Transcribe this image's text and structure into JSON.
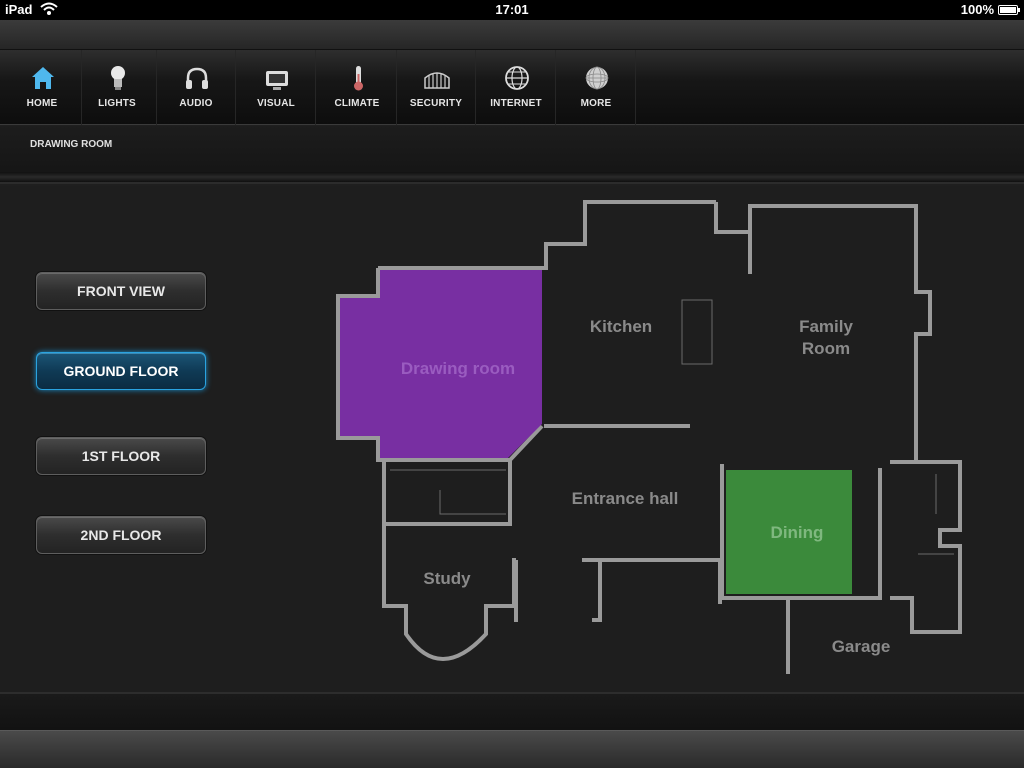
{
  "status_bar": {
    "carrier": "iPad",
    "time": "17:01",
    "battery": "100%",
    "wifi_icon": "wifi-icon",
    "battery_icon": "battery-icon"
  },
  "nav": {
    "items": [
      {
        "label": "HOME",
        "icon": "home-icon",
        "active": true
      },
      {
        "label": "LIGHTS",
        "icon": "lightbulb-icon"
      },
      {
        "label": "AUDIO",
        "icon": "headphones-icon"
      },
      {
        "label": "VISUAL",
        "icon": "tv-icon"
      },
      {
        "label": "CLIMATE",
        "icon": "thermometer-icon"
      },
      {
        "label": "SECURITY",
        "icon": "gate-icon"
      },
      {
        "label": "INTERNET",
        "icon": "globe-icon"
      },
      {
        "label": "MORE",
        "icon": "sphere-icon"
      }
    ]
  },
  "breadcrumb": "DRAWING ROOM",
  "floors": {
    "buttons": [
      "FRONT VIEW",
      "GROUND FLOOR",
      "1ST FLOOR",
      "2ND FLOOR"
    ],
    "active": "GROUND FLOOR"
  },
  "floorplan": {
    "rooms": {
      "drawing_room": "Drawing room",
      "kitchen": "Kitchen",
      "family_room_1": "Family",
      "family_room_2": "Room",
      "entrance_hall": "Entrance hall",
      "dining": "Dining",
      "study": "Study",
      "garage": "Garage"
    },
    "colors": {
      "drawing_room_fill": "#7b2fa6",
      "dining_fill": "#3b8a3b",
      "wall": "#9a9a9a",
      "room_label": "#8a8a8a",
      "accent": "#2aa3e0"
    }
  }
}
